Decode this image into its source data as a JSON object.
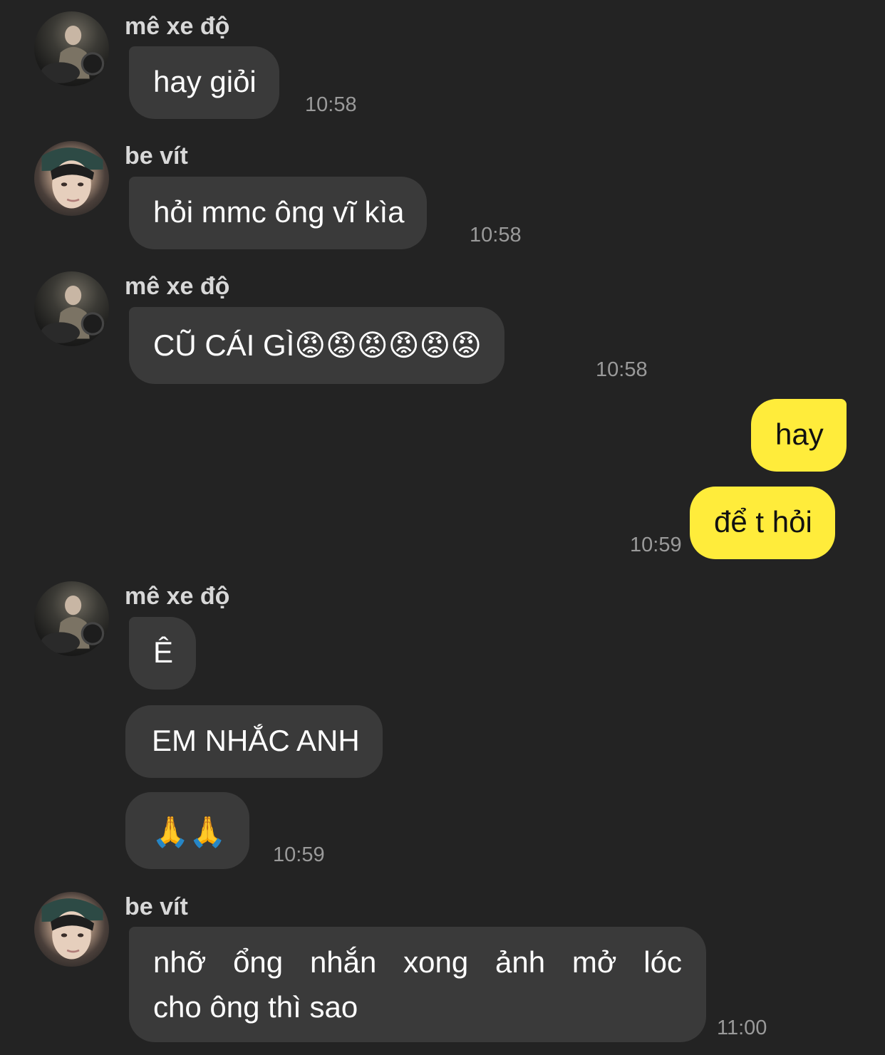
{
  "chat": {
    "messages": [
      {
        "sender": "mê xe độ",
        "text": "hay giỏi",
        "time": "10:58"
      },
      {
        "sender": "be vít",
        "text": "hỏi mmc ông vĩ kìa",
        "time": "10:58"
      },
      {
        "sender": "mê xe độ",
        "text": "CŨ CÁI GÌ😡😡😡😡😡😡",
        "time": "10:58"
      },
      {
        "text": "hay"
      },
      {
        "text": "để t hỏi",
        "time": "10:59"
      },
      {
        "sender": "mê xe độ",
        "text": "Ê"
      },
      {
        "text": "EM NHẮC ANH"
      },
      {
        "text": "🙏🙏",
        "time": "10:59"
      },
      {
        "sender": "be vít",
        "text_line1": [
          "nhỡ",
          "ổng",
          "nhắn",
          "xong",
          "ảnh",
          "mở",
          "lóc"
        ],
        "text_line2": "cho ông thì sao",
        "time": "11:00"
      }
    ]
  },
  "colors": {
    "background": "#232323",
    "incoming_bubble": "#3a3a3a",
    "outgoing_bubble": "#ffec3b"
  },
  "icons": {
    "avatar_1": "avatar-me-xe-do-icon",
    "avatar_2": "avatar-be-vit-icon"
  }
}
